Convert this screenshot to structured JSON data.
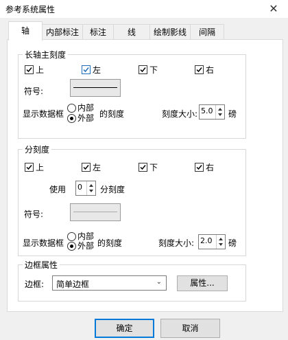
{
  "window": {
    "title": "参考系统属性"
  },
  "tabs": [
    "轴",
    "内部标注",
    "标注",
    "线",
    "绘制影线",
    "间隔"
  ],
  "major": {
    "title": "长轴主刻度",
    "checks": [
      "上",
      "左",
      "下",
      "右"
    ],
    "symbol_label": "符号:",
    "show_frame_label": "显示数据框",
    "radio_inner": "内部",
    "radio_outer": "外部",
    "of_ticks": "的刻度",
    "tick_size_label": "刻度大小:",
    "tick_size": "5.0",
    "unit": "磅"
  },
  "minor": {
    "title": "分刻度",
    "checks": [
      "上",
      "左",
      "下",
      "右"
    ],
    "use_label": "使用",
    "use_value": "0",
    "minor_ticks": "分刻度",
    "symbol_label": "符号:",
    "show_frame_label": "显示数据框",
    "radio_inner": "内部",
    "radio_outer": "外部",
    "of_ticks": "的刻度",
    "tick_size_label": "刻度大小:",
    "tick_size": "2.0",
    "unit": "磅"
  },
  "frame": {
    "title": "边框属性",
    "border_label": "边框:",
    "border_value": "简单边框",
    "props_button": "属性..."
  },
  "footer": {
    "ok": "确定",
    "cancel": "取消"
  },
  "colors": {
    "accent": "#0078d7",
    "check_blue": "#1e6bb8"
  }
}
